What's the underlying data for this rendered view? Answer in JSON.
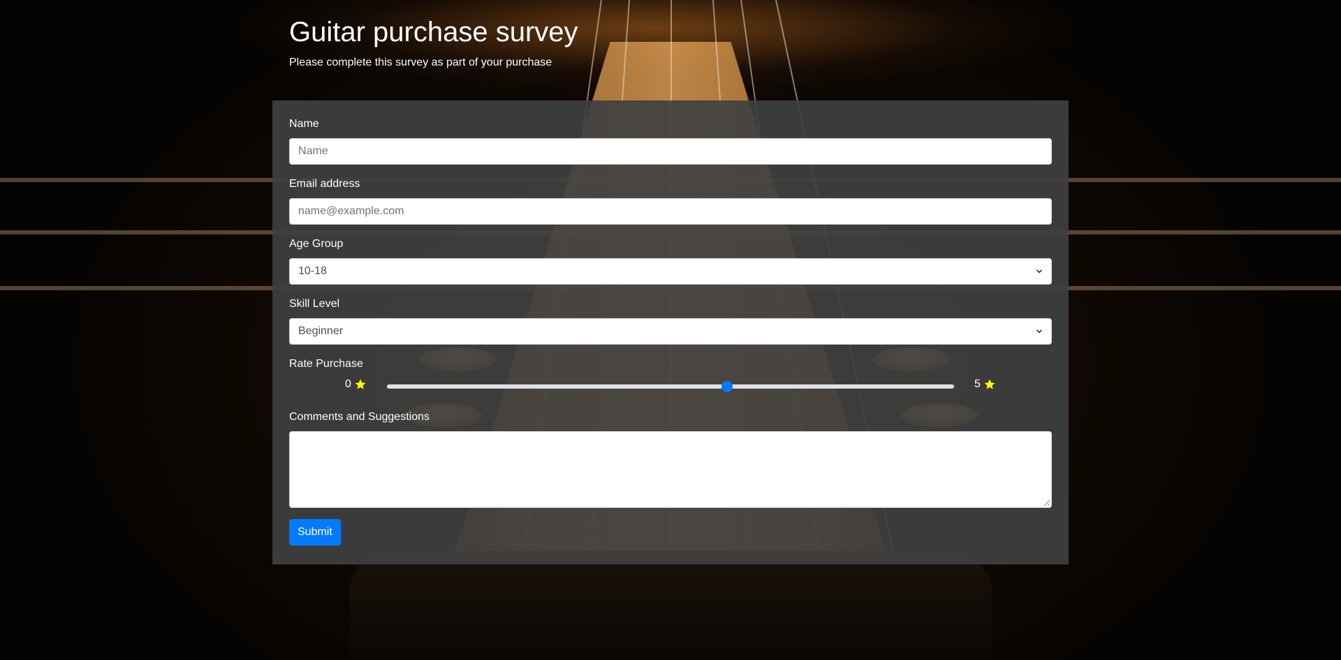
{
  "header": {
    "title": "Guitar purchase survey",
    "subtitle": "Please complete this survey as part of your purchase"
  },
  "form": {
    "name": {
      "label": "Name",
      "placeholder": "Name",
      "value": ""
    },
    "email": {
      "label": "Email address",
      "placeholder": "name@example.com",
      "value": ""
    },
    "age_group": {
      "label": "Age Group",
      "selected": "10-18"
    },
    "skill_level": {
      "label": "Skill Level",
      "selected": "Beginner"
    },
    "rating": {
      "label": "Rate Purchase",
      "min_label": "0",
      "max_label": "5",
      "min": 0,
      "max": 5,
      "value": 3,
      "icon": "star-icon",
      "star_color": "#ffff00",
      "thumb_color": "#007bff"
    },
    "comments": {
      "label": "Comments and Suggestions",
      "value": ""
    },
    "submit_label": "Submit"
  },
  "colors": {
    "card_background": "#404040",
    "button": "#007bff"
  }
}
